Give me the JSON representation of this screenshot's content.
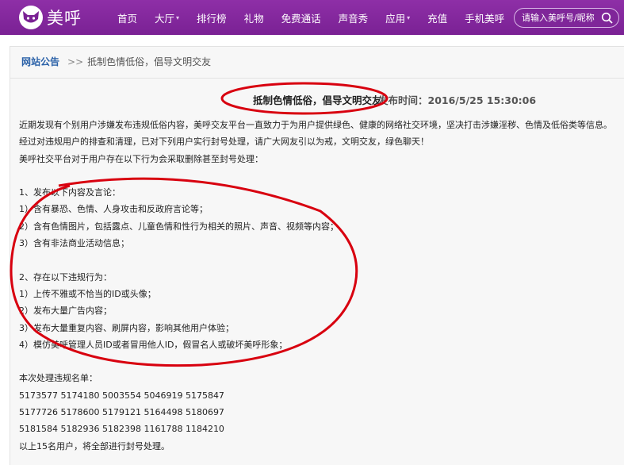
{
  "header": {
    "logo_text": "美呼",
    "nav": [
      {
        "label": "首页",
        "dropdown": false
      },
      {
        "label": "大厅",
        "dropdown": true
      },
      {
        "label": "排行榜",
        "dropdown": false
      },
      {
        "label": "礼物",
        "dropdown": false
      },
      {
        "label": "免费通话",
        "dropdown": false
      },
      {
        "label": "声音秀",
        "dropdown": false
      },
      {
        "label": "应用",
        "dropdown": true
      },
      {
        "label": "充值",
        "dropdown": false
      },
      {
        "label": "手机美呼",
        "dropdown": false
      }
    ],
    "search": {
      "placeholder": "请输入美呼号/昵称",
      "value": ""
    }
  },
  "breadcrumb": {
    "home": "网站公告",
    "separator": ">>",
    "current": "抵制色情低俗，倡导文明交友"
  },
  "article": {
    "title": "抵制色情低俗，倡导文明交友",
    "publish_label": "发布时间：",
    "publish_time": "2016/5/25 15:30:06",
    "intro": [
      "近期发现有个别用户涉嫌发布违规低俗内容，美呼交友平台一直致力于为用户提供绿色、健康的网络社交环境，坚决打击涉嫌淫秽、色情及低俗类等信息。",
      "经过对违规用户的排查和清理，已对下列用户实行封号处理，请广大网友引以为戒，文明交友，绿色聊天！",
      "美呼社交平台对于用户存在以下行为会采取删除甚至封号处理："
    ],
    "section1": {
      "heading": "1、发布以下内容及言论：",
      "items": [
        "1）含有暴恐、色情、人身攻击和反政府言论等；",
        "2）含有色情图片，包括露点、儿童色情和性行为相关的照片、声音、视频等内容；",
        "3）含有非法商业活动信息；"
      ]
    },
    "section2": {
      "heading": "2、存在以下违规行为：",
      "items": [
        "1）上传不雅或不恰当的ID或头像；",
        "2）发布大量广告内容；",
        "3）发布大量重复内容、刷屏内容，影响其他用户体验；",
        "4）模仿美呼管理人员ID或者冒用他人ID，假冒名人或破坏美呼形象；"
      ]
    },
    "list_heading": "本次处理违规名单：",
    "banned_rows": [
      "5173577 5174180 5003554 5046919 5175847",
      "5177726 5178600 5179121 5164498 5180697",
      "5181584 5182936 5182398 1161788 1184210"
    ],
    "closing": "以上15名用户，将全部进行封号处理。"
  },
  "colors": {
    "nav_bg": "#7a2194",
    "link_blue": "#2a61a8",
    "annotation_red": "#d8000f"
  }
}
